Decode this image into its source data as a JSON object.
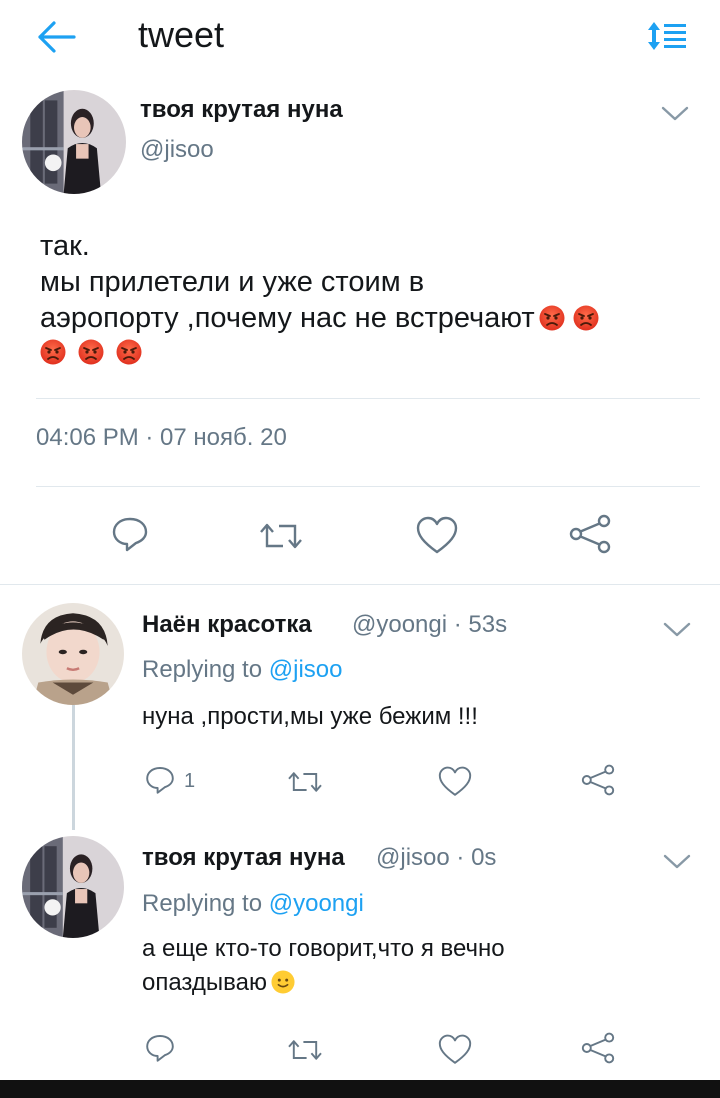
{
  "header": {
    "title": "tweet",
    "back_icon": "arrow-left-icon",
    "sort_icon": "sort-icon",
    "accent": "#1da1f2"
  },
  "main_tweet": {
    "author_name": "твоя крутая нуна",
    "author_handle": "@jisoo",
    "text_line1": "так.",
    "text_line2": "мы прилетели и уже стоим в",
    "text_line3": "аэропорту ,почему нас не встречают",
    "emoji": "angry-face-emoji",
    "timestamp": "04:06 PM · 07 нояб. 20",
    "actions": [
      "reply-icon",
      "retweet-icon",
      "like-icon",
      "share-icon"
    ]
  },
  "replies": [
    {
      "author_name": "Наён красотка",
      "author_handle": "@yoongi",
      "time": "· 53s",
      "replying_label": "Replying to",
      "replying_handle": "@jisoo",
      "text_line1": "нуна ,прости,мы уже бежим !!!",
      "reply_count": "1"
    },
    {
      "author_name": "твоя крутая нуна",
      "author_handle": "@jisoo",
      "time": "· 0s",
      "replying_label": "Replying to",
      "replying_handle": "@yoongi",
      "text_line1": "а еще кто-то говорит,что я вечно",
      "text_line2": "опаздываю",
      "emoji": "slightly-smiling-face-emoji"
    }
  ]
}
